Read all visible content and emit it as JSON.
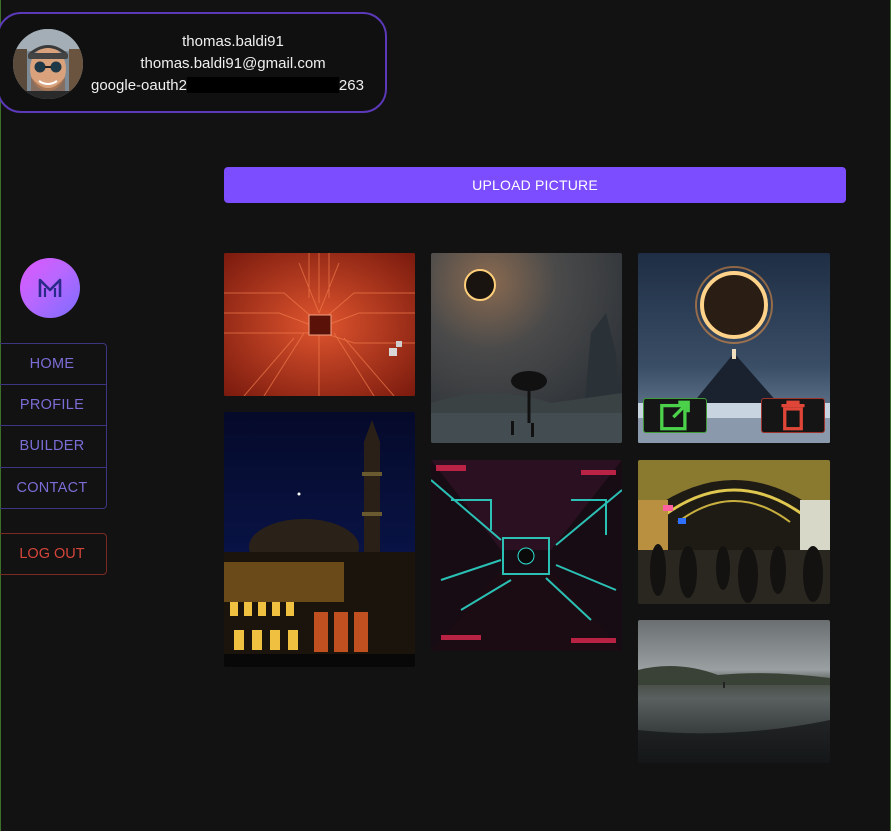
{
  "user": {
    "username": "thomas.baldi91",
    "email": "thomas.baldi91@gmail.com",
    "oauth_prefix": "google-oauth2",
    "oauth_suffix": "263"
  },
  "nav": {
    "items": [
      "HOME",
      "PROFILE",
      "BUILDER",
      "CONTACT"
    ],
    "logout": "LOG OUT"
  },
  "upload_label": "UPLOAD PICTURE",
  "colors": {
    "accent": "#7c4dff",
    "open_button": "#3f9b38",
    "delete_button": "#a0322c",
    "background": "#121212"
  },
  "icons": {
    "logo": "m-logo-icon",
    "open": "open-external-icon",
    "delete": "trash-icon"
  }
}
